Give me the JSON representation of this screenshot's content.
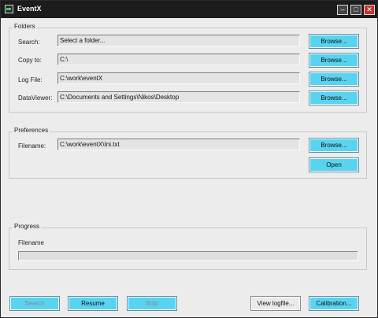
{
  "window": {
    "title": "EventX"
  },
  "folders": {
    "title": "Folders",
    "rows": [
      {
        "label": "Search:",
        "value": "Select a folder...",
        "button": "Browse..."
      },
      {
        "label": "Copy to:",
        "value": "C:\\",
        "button": "Browse..."
      },
      {
        "label": "Log File:",
        "value": "C:\\work\\eventX",
        "button": "Browse..."
      },
      {
        "label": "DataViewer:",
        "value": "C:\\Documents and Settings\\Nikos\\Desktop",
        "button": "Browse..."
      }
    ]
  },
  "preferences": {
    "title": "Preferences",
    "filename_label": "Filename:",
    "filename_value": "C:\\work\\eventX\\Ini.txt",
    "browse_button": "Browse...",
    "open_button": "Open"
  },
  "progress": {
    "title": "Progress",
    "filename_label": "Filename",
    "value": 0
  },
  "actions": {
    "search": "Search",
    "resume": "Resume",
    "stop": "Stop",
    "view_logfile": "View logfile...",
    "calibration": "Calibration..."
  }
}
